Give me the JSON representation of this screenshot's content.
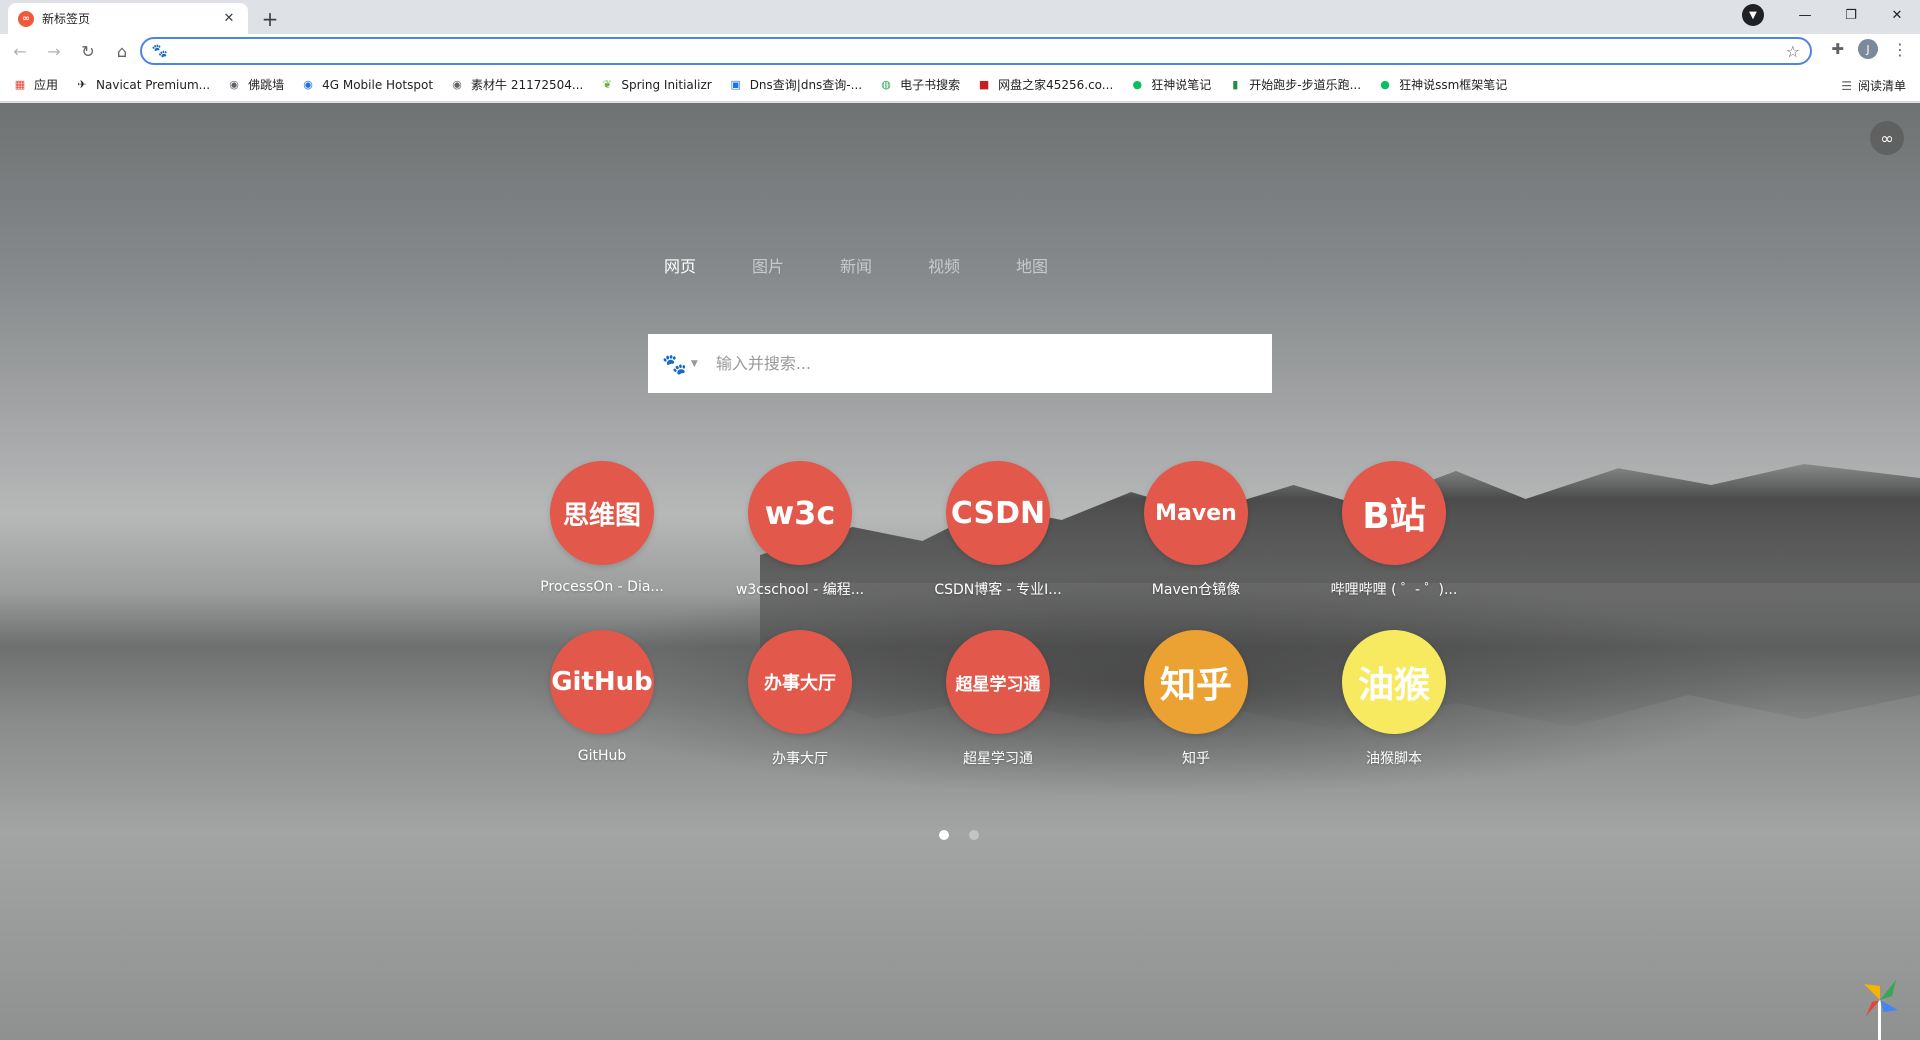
{
  "tab": {
    "title": "新标签页",
    "favicon": "infinity-favicon"
  },
  "toolbar": {
    "omnibox_value": "",
    "search_engine_icon": "baidu-paw-icon",
    "profile_initial": "J"
  },
  "bookmarks": [
    {
      "label": "应用",
      "icon": "apps-grid-icon",
      "color": "#e94235"
    },
    {
      "label": "Navicat Premium...",
      "icon": "navicat-icon",
      "color": "#202124"
    },
    {
      "label": "佛跳墙",
      "icon": "globe-icon",
      "color": "#5f6368"
    },
    {
      "label": "4G Mobile Hotspot",
      "icon": "globe-icon",
      "color": "#1a73e8"
    },
    {
      "label": "素材牛 21172504...",
      "icon": "globe-icon",
      "color": "#5f6368"
    },
    {
      "label": "Spring Initializr",
      "icon": "spring-icon",
      "color": "#6db33f"
    },
    {
      "label": "Dns查询|dns查询-...",
      "icon": "dns-icon",
      "color": "#1a73e8"
    },
    {
      "label": "电子书搜索",
      "icon": "ebook-icon",
      "color": "#34a853"
    },
    {
      "label": "网盘之家45256.co...",
      "icon": "45-icon",
      "color": "#c5221f"
    },
    {
      "label": "狂神说笔记",
      "icon": "wechat-icon",
      "color": "#07c160"
    },
    {
      "label": "开始跑步-步道乐跑...",
      "icon": "b-icon",
      "color": "#1e8e3e"
    },
    {
      "label": "狂神说ssm框架笔记",
      "icon": "wechat-icon",
      "color": "#07c160"
    }
  ],
  "reading_list": "阅读清单",
  "search": {
    "tabs": [
      "网页",
      "图片",
      "新闻",
      "视频",
      "地图"
    ],
    "active_tab": 0,
    "placeholder": "输入并搜索...",
    "engine_icon": "baidu-paw-icon"
  },
  "sites": [
    {
      "text": "思维图",
      "label": "ProcessOn - Dia...",
      "color": "#e2584a",
      "text_color": "#ffffff",
      "font_size": 26
    },
    {
      "text": "w3c",
      "label": "w3cschool - 编程...",
      "color": "#e2584a",
      "text_color": "#ffffff",
      "font_size": 32
    },
    {
      "text": "CSDN",
      "label": "CSDN博客 - 专业I...",
      "color": "#e2584a",
      "text_color": "#ffffff",
      "font_size": 30
    },
    {
      "text": "Maven",
      "label": "Maven仓镜像",
      "color": "#e2584a",
      "text_color": "#ffffff",
      "font_size": 22
    },
    {
      "text": "B站",
      "label": "哔哩哔哩 ( ゜- ゜)...",
      "color": "#e2584a",
      "text_color": "#ffffff",
      "font_size": 36
    },
    {
      "text": "GitHub",
      "label": "GitHub",
      "color": "#e2584a",
      "text_color": "#ffffff",
      "font_size": 26
    },
    {
      "text": "办事大厅",
      "label": "办事大厅",
      "color": "#e2584a",
      "text_color": "#ffffff",
      "font_size": 18
    },
    {
      "text": "超星学习通",
      "label": "超星学习通",
      "color": "#e2584a",
      "text_color": "#ffffff",
      "font_size": 17
    },
    {
      "text": "知乎",
      "label": "知乎",
      "color": "#eba233",
      "text_color": "#ffffff",
      "font_size": 36
    },
    {
      "text": "油猴",
      "label": "油猴脚本",
      "color": "#f8ea60",
      "text_color": "#ffffff",
      "font_size": 36
    }
  ],
  "pagination": {
    "pages": 2,
    "current": 1
  },
  "colors": {
    "accent_blue": "#4a86e8",
    "site_red": "#e2584a",
    "zhihu_orange": "#eba233",
    "tampermonkey_yellow": "#f8ea60"
  }
}
